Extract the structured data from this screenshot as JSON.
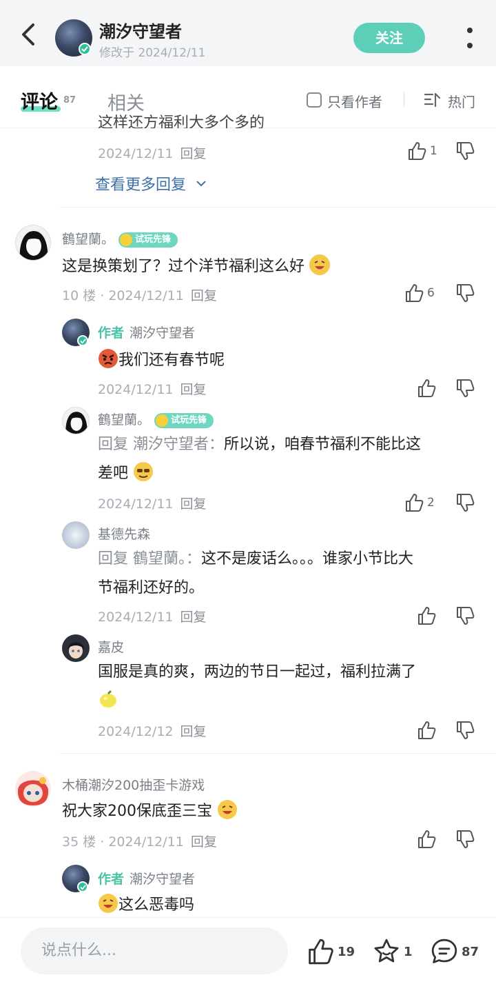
{
  "header": {
    "author_name": "潮汐守望者",
    "modified": "修改于 2024/12/11",
    "follow_label": "关注"
  },
  "tabs": {
    "comments_label": "评论",
    "comments_count": "87",
    "related_label": "相关",
    "author_only_label": "只看作者",
    "sort_label": "热门"
  },
  "top_partial": {
    "cut_text": "这样还方福利大多个多的",
    "time": "2024/12/11",
    "reply_label": "回复",
    "likes": "1",
    "more_replies_label": "查看更多回复"
  },
  "comment1": {
    "username": "鶴望蘭。",
    "badge": "试玩先锋",
    "text": "这是换策划了？过个洋节福利这么好",
    "meta": "10 楼 · 2024/12/11",
    "reply_label": "回复",
    "likes": "6",
    "replies": [
      {
        "author_tag": "作者",
        "username": "潮汐守望者",
        "text": "我们还有春节呢",
        "time": "2024/12/11",
        "reply_label": "回复",
        "likes": ""
      },
      {
        "username": "鶴望蘭。",
        "badge": "试玩先锋",
        "reply_to": "回复 潮汐守望者：",
        "text_line1": "所以说，咱春节福利不能比这",
        "text_line2": "差吧",
        "time": "2024/12/11",
        "reply_label": "回复",
        "likes": "2"
      },
      {
        "username": "基德先森",
        "reply_to": "回复 鶴望蘭。：",
        "text_line1": "这不是废话么。。。谁家小节比大",
        "text_line2": "节福利还好的。",
        "time": "2024/12/11",
        "reply_label": "回复",
        "likes": ""
      },
      {
        "username": "嘉皮",
        "text_line1": "国服是真的爽，两边的节日一起过，福利拉满了",
        "time": "2024/12/12",
        "reply_label": "回复",
        "likes": ""
      }
    ]
  },
  "comment2": {
    "username": "木桶潮汐200抽歪卡游戏",
    "text": "祝大家200保底歪三宝",
    "meta": "35 楼 · 2024/12/11",
    "reply_label": "回复",
    "reply": {
      "author_tag": "作者",
      "username": "潮汐守望者",
      "text": "这么恶毒吗"
    }
  },
  "bottom_bar": {
    "input_placeholder": "说点什么...",
    "likes": "19",
    "favorites": "1",
    "comments": "87"
  },
  "colors": {
    "accent": "#5dcfb8",
    "author_tag": "#4cc3a6",
    "badge": "#6fd6c0",
    "link": "#3d6fa8"
  }
}
